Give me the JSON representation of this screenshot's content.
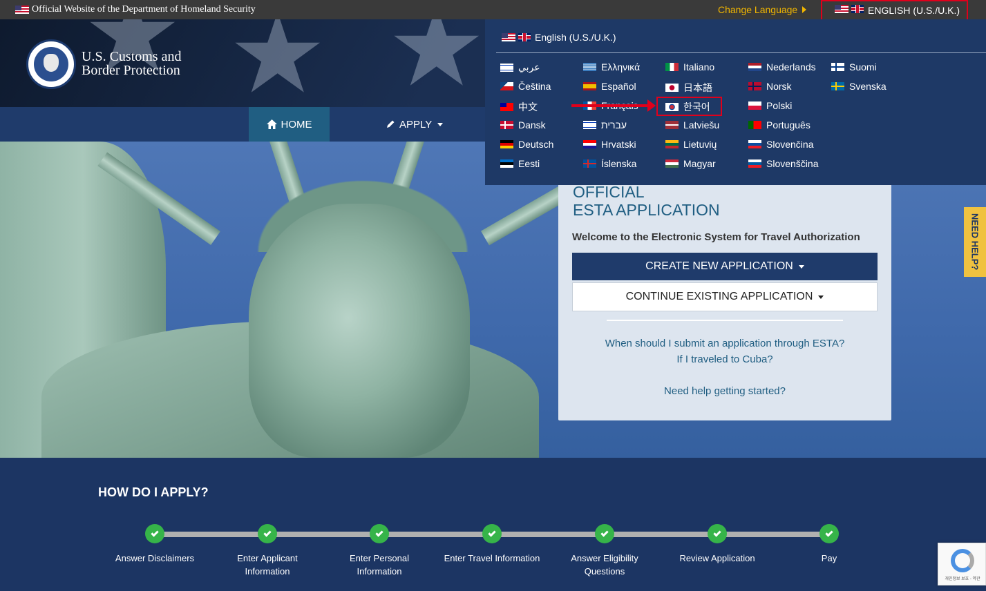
{
  "topbar": {
    "official_text": "Official Website of the Department of Homeland Security",
    "change_language": "Change Language",
    "current_language": "ENGLISH (U.S./U.K.)"
  },
  "header": {
    "agency_line1": "U.S. Customs and",
    "agency_line2": "Border Protection"
  },
  "nav": {
    "home": "HOME",
    "apply": "APPLY"
  },
  "language_menu": {
    "header_label": "English (U.S./U.K.)",
    "columns": [
      [
        {
          "label": "عربي",
          "flag": "israel-flag"
        },
        {
          "label": "Čeština",
          "flag": "czech-flag"
        },
        {
          "label": "中文",
          "flag": "taiwan-flag"
        },
        {
          "label": "Dansk",
          "flag": "denmark-flag"
        },
        {
          "label": "Deutsch",
          "flag": "germany-flag"
        },
        {
          "label": "Eesti",
          "flag": "estonia-flag"
        }
      ],
      [
        {
          "label": "Ελληνικά",
          "flag": "greece-flag"
        },
        {
          "label": "Español",
          "flag": "spain-flag"
        },
        {
          "label": "Français",
          "flag": "france-flag"
        },
        {
          "label": "עברית",
          "flag": "israel-flag"
        },
        {
          "label": "Hrvatski",
          "flag": "croatia-flag"
        },
        {
          "label": "Íslenska",
          "flag": "iceland-flag"
        }
      ],
      [
        {
          "label": "Italiano",
          "flag": "italy-flag"
        },
        {
          "label": "日本語",
          "flag": "japan-flag"
        },
        {
          "label": "한국어",
          "flag": "korea-flag"
        },
        {
          "label": "Latviešu",
          "flag": "latvia-flag"
        },
        {
          "label": "Lietuvių",
          "flag": "lithuania-flag"
        },
        {
          "label": "Magyar",
          "flag": "hungary-flag"
        }
      ],
      [
        {
          "label": "Nederlands",
          "flag": "netherlands-flag"
        },
        {
          "label": "Norsk",
          "flag": "norway-flag"
        },
        {
          "label": "Polski",
          "flag": "poland-flag"
        },
        {
          "label": "Português",
          "flag": "portugal-flag"
        },
        {
          "label": "Slovenčina",
          "flag": "slovakia-flag"
        },
        {
          "label": "Slovenščina",
          "flag": "slovenia-flag"
        }
      ],
      [
        {
          "label": "Suomi",
          "flag": "finland-flag"
        },
        {
          "label": "Svenska",
          "flag": "sweden-flag"
        }
      ]
    ]
  },
  "card": {
    "title_line1": "OFFICIAL",
    "title_line2": "ESTA APPLICATION",
    "welcome": "Welcome to the Electronic System for Travel Authorization",
    "create_button": "CREATE NEW APPLICATION",
    "continue_button": "CONTINUE EXISTING APPLICATION",
    "link_when": "When should I submit an application through ESTA?",
    "link_cuba": "If I traveled to Cuba?",
    "link_help": "Need help getting started?"
  },
  "need_help": "NEED HELP?",
  "how": {
    "title": "HOW DO I APPLY?",
    "steps": [
      {
        "line1": "Answer Disclaimers",
        "line2": ""
      },
      {
        "line1": "Enter Applicant",
        "line2": "Information"
      },
      {
        "line1": "Enter Personal",
        "line2": "Information"
      },
      {
        "line1": "Enter Travel Information",
        "line2": ""
      },
      {
        "line1": "Answer Eligibility",
        "line2": "Questions"
      },
      {
        "line1": "Review Application",
        "line2": ""
      },
      {
        "line1": "Pay",
        "line2": ""
      }
    ]
  },
  "recaptcha_text": "개인정보 보호 - 약관",
  "colors": {
    "navy": "#1c3563",
    "accent_blue": "#205e82",
    "gold": "#f2b600",
    "highlight_red": "#e0001b",
    "step_green": "#36b449"
  }
}
